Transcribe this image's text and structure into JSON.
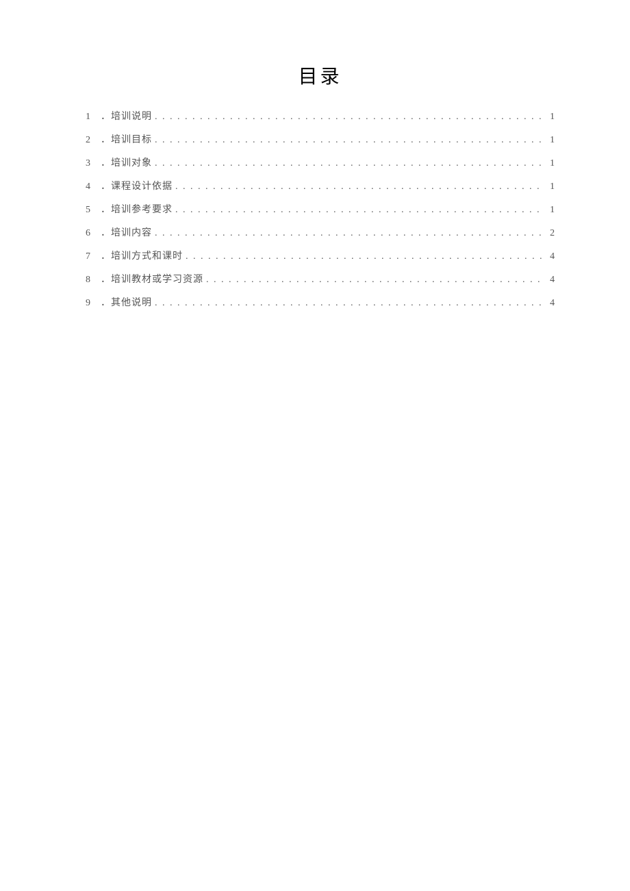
{
  "title": "目录",
  "toc": [
    {
      "num": "1",
      "label": "．培训说明",
      "page": "1"
    },
    {
      "num": "2",
      "label": "．培训目标",
      "page": "1"
    },
    {
      "num": "3",
      "label": "．培训对象",
      "page": "1"
    },
    {
      "num": "4",
      "label": "．课程设计依据",
      "page": "1"
    },
    {
      "num": "5",
      "label": "．培训参考要求",
      "page": "1"
    },
    {
      "num": "6",
      "label": "．培训内容",
      "page": "2"
    },
    {
      "num": "7",
      "label": "．培训方式和课时",
      "page": "4"
    },
    {
      "num": "8",
      "label": "．培训教材或学习资源",
      "page": "4"
    },
    {
      "num": "9",
      "label": "．其他说明",
      "page": "4"
    }
  ]
}
